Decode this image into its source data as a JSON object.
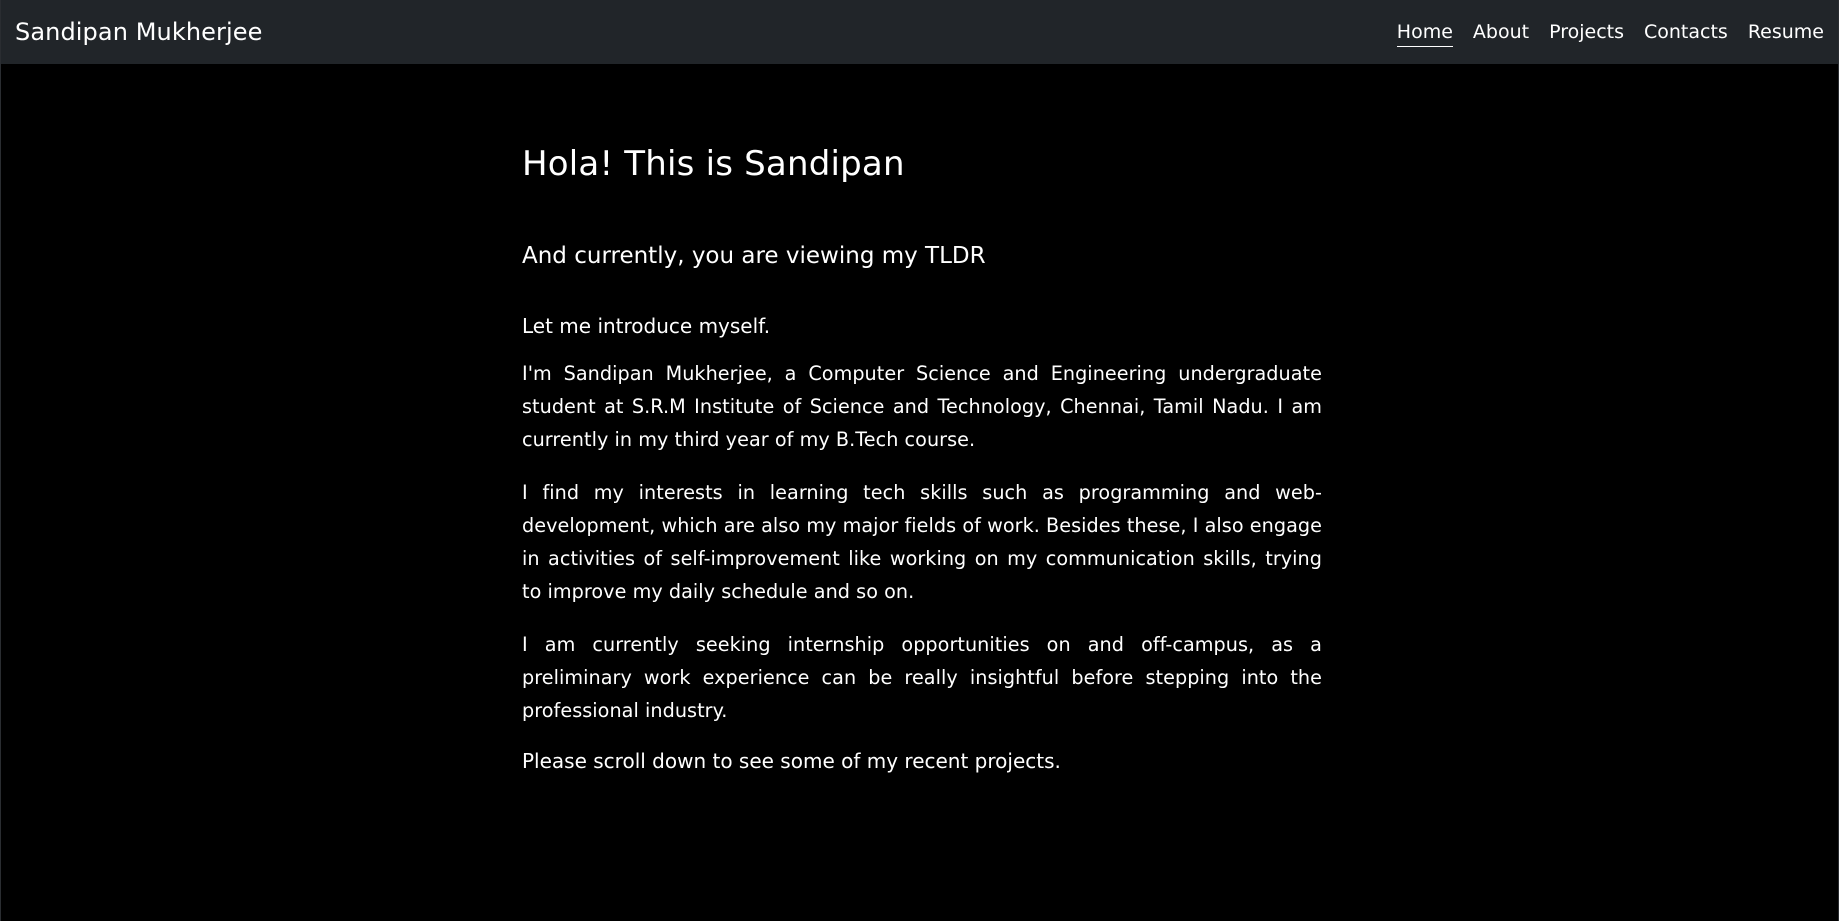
{
  "navbar": {
    "brand": "Sandipan Mukherjee",
    "links": [
      {
        "label": "Home",
        "active": true
      },
      {
        "label": "About",
        "active": false
      },
      {
        "label": "Projects",
        "active": false
      },
      {
        "label": "Contacts",
        "active": false
      },
      {
        "label": "Resume",
        "active": false
      }
    ]
  },
  "main": {
    "title": "Hola! This is Sandipan",
    "subtitle": "And currently, you are viewing my TLDR",
    "intro": "Let me introduce myself.",
    "paragraphs": [
      "I'm Sandipan Mukherjee, a Computer Science and Engineering undergraduate student at S.R.M Institute of Science and Technology, Chennai, Tamil Nadu. I am currently in my third year of my B.Tech course.",
      "I find my interests in learning tech skills such as programming and web-development, which are also my major fields of work. Besides these, I also engage in activities of self-improvement like working on my communication skills, trying to improve my daily schedule and so on.",
      "I am currently seeking internship opportunities on and off-campus, as a preliminary work experience can be really insightful before stepping into the professional industry."
    ],
    "closing": "Please scroll down to see some of my recent projects."
  },
  "colors": {
    "navbar_bg": "#212529",
    "page_bg": "#000000",
    "text": "#ffffff"
  }
}
